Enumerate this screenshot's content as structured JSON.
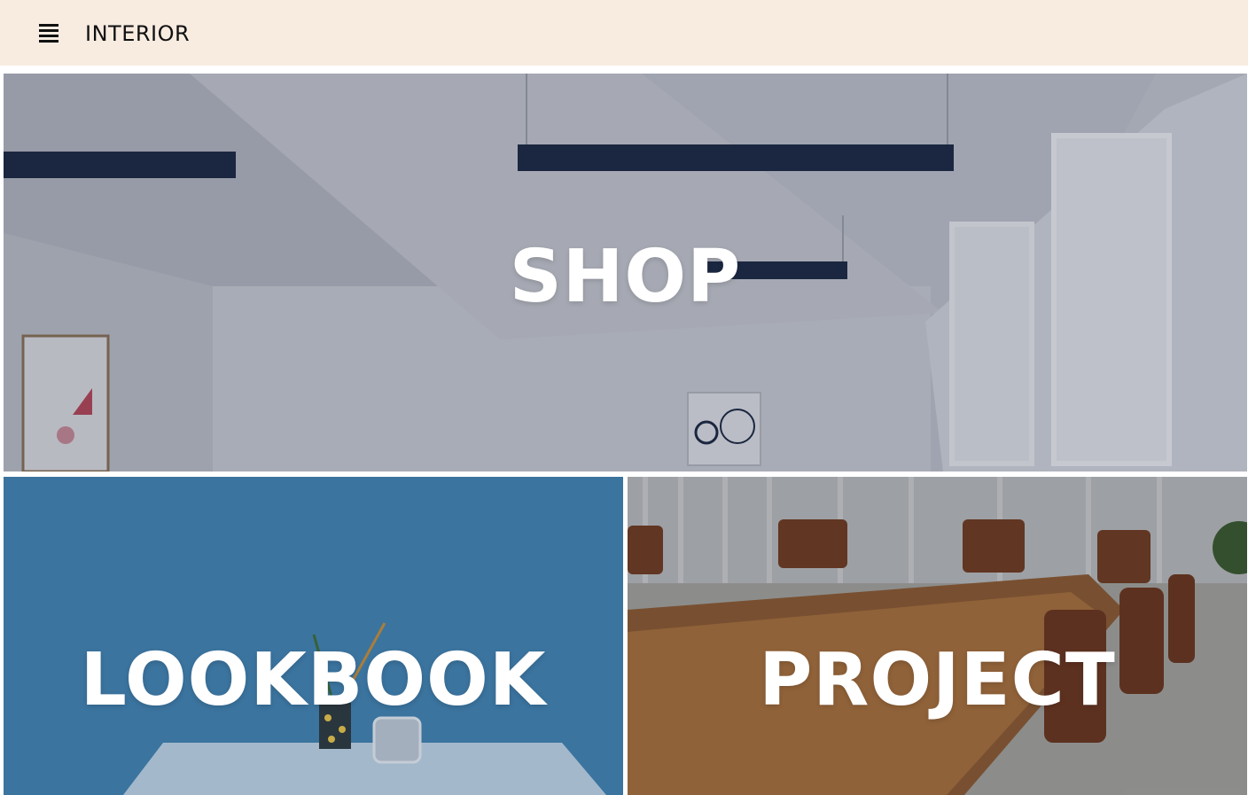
{
  "header": {
    "menu_icon": "hamburger-menu-icon",
    "brand": "INTERIOR",
    "background": "#f8ece1"
  },
  "tiles": [
    {
      "label": "SHOP"
    },
    {
      "label": "LOOKBOOK"
    },
    {
      "label": "PROJECT"
    }
  ]
}
